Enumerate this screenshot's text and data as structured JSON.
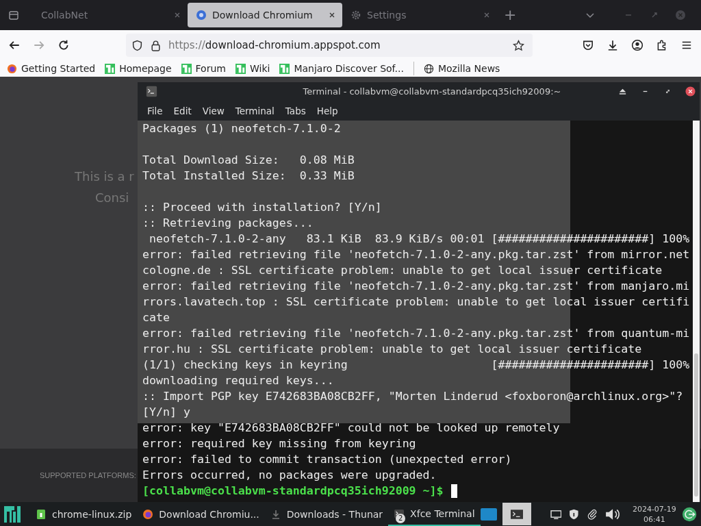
{
  "browser": {
    "tabs": [
      {
        "label": "CollabNet",
        "selected": false,
        "kind": "plain"
      },
      {
        "label": "Download Chromium",
        "selected": true,
        "kind": "site"
      },
      {
        "label": "Settings",
        "selected": false,
        "kind": "settings"
      }
    ],
    "new_tab": "+",
    "url": {
      "scheme": "https://",
      "host": "download-chromium.appspot.com"
    },
    "bookmarks": [
      {
        "label": "Getting Started",
        "kind": "browser"
      },
      {
        "label": "Homepage",
        "kind": "distro"
      },
      {
        "label": "Forum",
        "kind": "distro"
      },
      {
        "label": "Wiki",
        "kind": "distro"
      },
      {
        "label": "Manjaro Discover Sof...",
        "kind": "distro"
      },
      {
        "label": "Mozilla News",
        "kind": "feed"
      }
    ],
    "page": {
      "texts": [
        "This is a r",
        "Consi"
      ],
      "footer_label": "SUPPORTED PLATFORMS:"
    }
  },
  "terminal": {
    "title": "Terminal - collabvm@collabvm-standardpcq35ich92009:~",
    "menu": [
      "File",
      "Edit",
      "View",
      "Terminal",
      "Tabs",
      "Help"
    ],
    "lines": [
      {
        "kind": "normal",
        "text": "Packages (1) neofetch-7.1.0-2"
      },
      {
        "kind": "blank"
      },
      {
        "kind": "normal",
        "text": "Total Download Size:   0.08 MiB"
      },
      {
        "kind": "normal",
        "text": "Total Installed Size:  0.33 MiB"
      },
      {
        "kind": "blank"
      },
      {
        "kind": "normal",
        "text": ":: Proceed with installation? [Y/n]"
      },
      {
        "kind": "normal",
        "text": ":: Retrieving packages..."
      },
      {
        "kind": "normal",
        "text": " neofetch-7.1.0-2-any   83.1 KiB  83.9 KiB/s 00:01 [######################] 100%"
      },
      {
        "kind": "normal",
        "text": "error: failed retrieving file 'neofetch-7.1.0-2-any.pkg.tar.zst' from mirror.net"
      },
      {
        "kind": "normal",
        "text": "cologne.de : SSL certificate problem: unable to get local issuer certificate"
      },
      {
        "kind": "normal",
        "text": "error: failed retrieving file 'neofetch-7.1.0-2-any.pkg.tar.zst' from manjaro.mi"
      },
      {
        "kind": "normal",
        "text": "rrors.lavatech.top : SSL certificate problem: unable to get local issuer certifi"
      },
      {
        "kind": "normal",
        "text": "cate"
      },
      {
        "kind": "normal",
        "text": "error: failed retrieving file 'neofetch-7.1.0-2-any.pkg.tar.zst' from quantum-mi"
      },
      {
        "kind": "normal",
        "text": "rror.hu : SSL certificate problem: unable to get local issuer certificate"
      },
      {
        "kind": "normal",
        "text": "(1/1) checking keys in keyring                     [######################] 100%"
      },
      {
        "kind": "normal",
        "text": "downloading required keys..."
      },
      {
        "kind": "normal",
        "text": ":: Import PGP key E742683BA08CB2FF, \"Morten Linderud <foxboron@archlinux.org>\"?"
      },
      {
        "kind": "normal",
        "text": "[Y/n] y"
      },
      {
        "kind": "normal",
        "text": "error: key \"E742683BA08CB2FF\" could not be looked up remotely"
      },
      {
        "kind": "normal",
        "text": "error: required key missing from keyring"
      },
      {
        "kind": "normal",
        "text": "error: failed to commit transaction (unexpected error)"
      },
      {
        "kind": "normal",
        "text": "Errors occurred, no packages were upgraded."
      },
      {
        "kind": "prompt",
        "text": "[collabvm@collabvm-standardpcq35ich92009 ~]$"
      }
    ]
  },
  "taskbar": {
    "items": [
      {
        "label": "chrome-linux.zip",
        "kind": "archive",
        "selected": false
      },
      {
        "label": "Download Chromiu...",
        "kind": "browser",
        "selected": false
      },
      {
        "label": "Downloads - Thunar",
        "kind": "files",
        "selected": false
      },
      {
        "label": "Xfce Terminal",
        "kind": "terminal",
        "selected": true,
        "badge": "2"
      }
    ],
    "date": "2024-07-19",
    "time": "06:41"
  }
}
